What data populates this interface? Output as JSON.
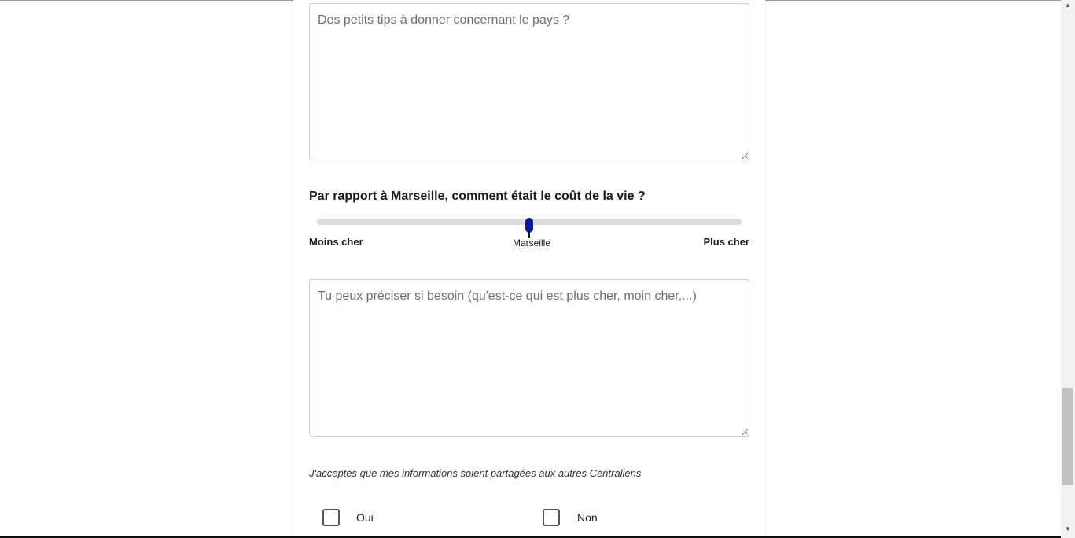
{
  "form": {
    "tips_placeholder": "Des petits tips à donner concernant le pays ?",
    "cost_question": "Par rapport à Marseille, comment était le coût de la vie ?",
    "cost_slider": {
      "min_label": "Moins cher",
      "max_label": "Plus cher",
      "value_label": "Marseille",
      "value_fraction": 0.5
    },
    "cost_details_placeholder": "Tu peux préciser si besoin (qu'est-ce qui est plus cher, moin cher,...)",
    "consent_label": "J'acceptes que mes informations soient partagées aux autres Centraliens",
    "consent_options": [
      {
        "label": "Oui",
        "checked": false
      },
      {
        "label": "Non",
        "checked": false
      }
    ]
  },
  "colors": {
    "slider_thumb": "#0a1aa0",
    "slider_track": "#dcdcdc"
  },
  "scrollbar": {
    "up_icon": "triangle-up",
    "down_icon": "triangle-down"
  }
}
